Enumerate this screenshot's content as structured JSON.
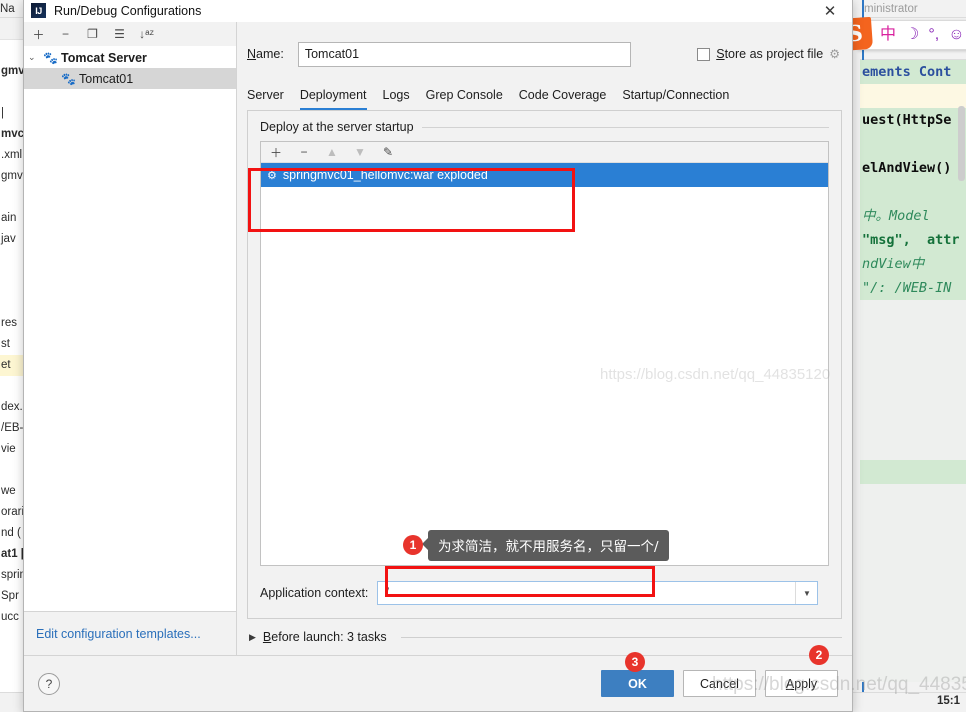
{
  "background": {
    "menu_hint": "Na",
    "editor_lines": [
      {
        "text": "ements Cont",
        "style": "band",
        "cls": "cd-blue"
      },
      {
        "text": "",
        "style": "band-y",
        "cls": "cd-dk"
      },
      {
        "text": "uest(HttpSe",
        "style": "band",
        "cls": "cd-dk"
      },
      {
        "text": "",
        "style": "band",
        "cls": "cd-dk"
      },
      {
        "text": "elAndView()",
        "style": "band",
        "cls": "cd-dk"
      },
      {
        "text": "",
        "style": "band",
        "cls": "cd-dk"
      },
      {
        "text": "中。Model",
        "style": "band",
        "cls": "cd-green"
      },
      {
        "text": "\"msg\",  attr",
        "style": "band",
        "cls": "cd-str"
      },
      {
        "text": "ndView中",
        "style": "band",
        "cls": "cd-green"
      },
      {
        "text": "\"/: /WEB-IN",
        "style": "band",
        "cls": "cd-green"
      }
    ],
    "top_strip_text": "ministrator",
    "status_position": "15:1",
    "tree_items": [
      {
        "label": "",
        "state": "plain"
      },
      {
        "label": "gmv",
        "state": "bold"
      },
      {
        "label": "",
        "state": "plain"
      },
      {
        "label": "|",
        "state": "plain"
      },
      {
        "label": "mvc0",
        "state": "bold"
      },
      {
        "label": ".xml",
        "state": "plain"
      },
      {
        "label": "gmv",
        "state": "plain"
      },
      {
        "label": "",
        "state": "plain"
      },
      {
        "label": "ain",
        "state": "plain"
      },
      {
        "label": "jav",
        "state": "plain"
      },
      {
        "label": "",
        "state": "plain"
      },
      {
        "label": "",
        "state": "plain"
      },
      {
        "label": "",
        "state": "plain"
      },
      {
        "label": "res",
        "state": "plain"
      },
      {
        "label": "st",
        "state": "plain"
      },
      {
        "label": "et",
        "state": "hl"
      },
      {
        "label": "",
        "state": "plain"
      },
      {
        "label": "dex.",
        "state": "plain"
      },
      {
        "label": "/EB-",
        "state": "plain"
      },
      {
        "label": "vie",
        "state": "plain"
      },
      {
        "label": "",
        "state": "plain"
      },
      {
        "label": "we",
        "state": "plain"
      },
      {
        "label": "orari",
        "state": "plain"
      },
      {
        "label": "nd (",
        "state": "plain"
      }
    ],
    "bottom_tree_items": [
      {
        "label": "at1 [",
        "state": "bold"
      },
      {
        "label": "sprin",
        "state": "plain"
      },
      {
        "label": "Spr",
        "state": "plain"
      },
      {
        "label": "ucc",
        "state": "plain"
      }
    ]
  },
  "ime": {
    "logo_letter": "S",
    "icons": [
      "中",
      "☽",
      "°,",
      "☺"
    ]
  },
  "watermarks": {
    "middle": "https://blog.csdn.net/qq_44835120",
    "bottom": "https://blog.csdn.net/qq_44835120"
  },
  "dialog": {
    "title": "Run/Debug Configurations",
    "app_icon_text": "IJ",
    "close_icon": "✕",
    "config_toolbar": [
      {
        "name": "add",
        "glyph": "＋"
      },
      {
        "name": "remove",
        "glyph": "−"
      },
      {
        "name": "copy",
        "glyph": "❐"
      },
      {
        "name": "save-folder",
        "glyph": "☰"
      },
      {
        "name": "sort",
        "glyph": "↓ᵃᶻ"
      }
    ],
    "config_tree": [
      {
        "label": "Tomcat Server",
        "bold": true,
        "icon": "🐱",
        "caret": "⌄",
        "selected": false
      },
      {
        "label": "Tomcat01",
        "bold": false,
        "icon": "🐱",
        "caret": "",
        "selected": true
      }
    ],
    "edit_templates_link": "Edit configuration templates...",
    "name_label": "Name:",
    "name_value": "Tomcat01",
    "store_as_project_file": "Store as project file",
    "store_checked": false,
    "tabs": [
      {
        "label": "Server",
        "active": false
      },
      {
        "label": "Deployment",
        "active": true
      },
      {
        "label": "Logs",
        "active": false
      },
      {
        "label": "Grep Console",
        "active": false
      },
      {
        "label": "Code Coverage",
        "active": false
      },
      {
        "label": "Startup/Connection",
        "active": false
      }
    ],
    "group_title": "Deploy at the server startup",
    "deploy_toolbar": [
      {
        "name": "add",
        "glyph": "＋",
        "dim": false
      },
      {
        "name": "remove",
        "glyph": "−",
        "dim": false
      },
      {
        "name": "move-up",
        "glyph": "▲",
        "dim": true
      },
      {
        "name": "move-down",
        "glyph": "▼",
        "dim": true
      },
      {
        "name": "edit",
        "glyph": "✎",
        "dim": false
      }
    ],
    "deploy_items": [
      {
        "label": "springmvc01_hellomvc:war exploded",
        "icon": "⚙",
        "selected": true
      }
    ],
    "application_context_label": "Application context:",
    "application_context_value": "/",
    "combo_arrow": "▼",
    "before_launch": "Before launch: 3 tasks",
    "before_launch_caret": "▶",
    "help_glyph": "?",
    "buttons": {
      "ok": "OK",
      "cancel": "Cancel",
      "apply": "Apply"
    }
  },
  "annotations": {
    "tooltip_text": "为求简洁，就不用服务名，只留一个/",
    "badge1": "1",
    "badge2": "2",
    "badge3": "3",
    "box_color": "#f21212"
  }
}
